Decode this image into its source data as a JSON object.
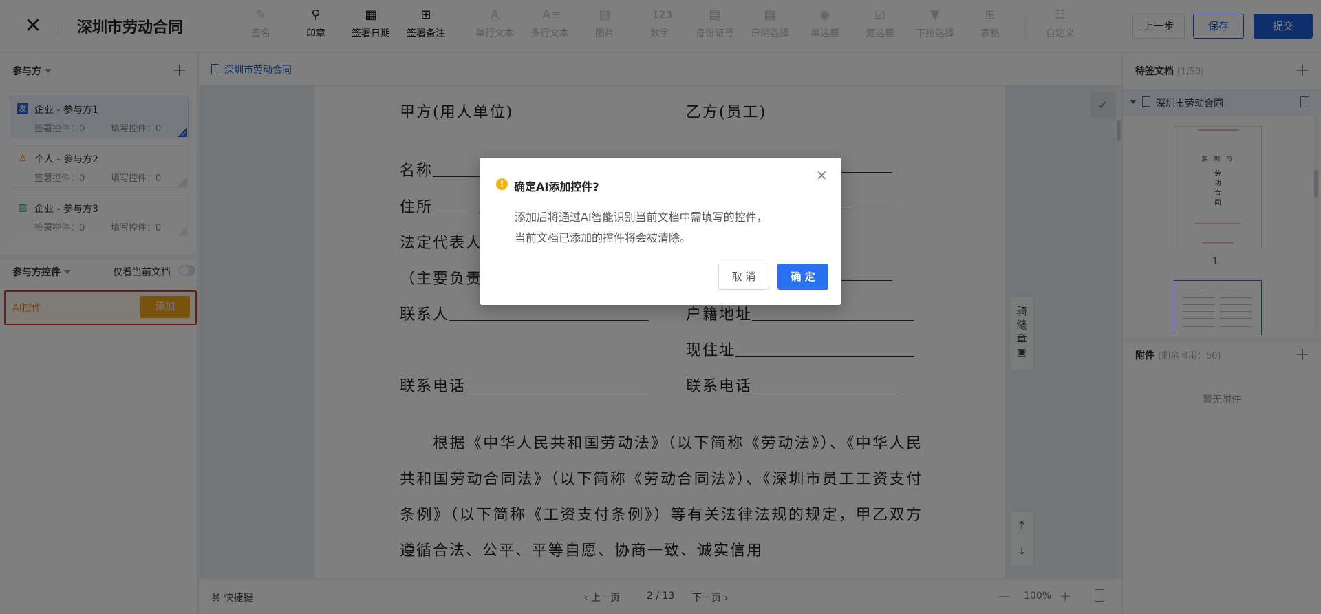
{
  "header": {
    "close_icon": "close-icon",
    "title": "深圳市劳动合同",
    "tools": [
      {
        "label": "签名",
        "icon": "pen-icon",
        "enabled": false
      },
      {
        "label": "印章",
        "icon": "stamp-icon",
        "enabled": true
      },
      {
        "label": "签署日期",
        "icon": "calendar-icon",
        "enabled": true
      },
      {
        "label": "签署备注",
        "icon": "note-plus-icon",
        "enabled": true
      },
      {
        "label": "单行文本",
        "icon": "text-a-icon",
        "enabled": false
      },
      {
        "label": "多行文本",
        "icon": "multiline-text-icon",
        "enabled": false
      },
      {
        "label": "图片",
        "icon": "image-icon",
        "enabled": false
      },
      {
        "label": "数字",
        "icon": "number-icon",
        "enabled": false,
        "glyph": "123"
      },
      {
        "label": "身份证号",
        "icon": "id-card-icon",
        "enabled": false
      },
      {
        "label": "日期选择",
        "icon": "date-picker-icon",
        "enabled": false
      },
      {
        "label": "单选框",
        "icon": "radio-icon",
        "enabled": false
      },
      {
        "label": "复选框",
        "icon": "checkbox-icon",
        "enabled": false
      },
      {
        "label": "下拉选择",
        "icon": "dropdown-icon",
        "enabled": false
      },
      {
        "label": "表格",
        "icon": "table-icon",
        "enabled": false
      },
      {
        "label": "自定义",
        "icon": "custom-sliders-icon",
        "enabled": false
      }
    ],
    "prev_step_label": "上一步",
    "save_label": "保存",
    "submit_label": "提交"
  },
  "left_panel": {
    "participants_title": "参与方",
    "participants": [
      {
        "badge": "发",
        "name": "企业 - 参与方1",
        "sign_ctrl": "签署控件：0",
        "fill_ctrl": "填写控件：0",
        "selected": true
      },
      {
        "badge": "",
        "name": "个人 - 参与方2",
        "sign_ctrl": "签署控件：0",
        "fill_ctrl": "填写控件：0",
        "selected": false
      },
      {
        "badge": "",
        "name": "企业 - 参与方3",
        "sign_ctrl": "签署控件：0",
        "fill_ctrl": "填写控件：0",
        "selected": false
      }
    ],
    "controls_title": "参与方控件",
    "only_current_doc_label": "仅看当前文档",
    "only_current_doc_on": false,
    "ai_control_label": "AI控件",
    "ai_add_label": "添加"
  },
  "document": {
    "tab_name": "深圳市劳动合同",
    "lines": {
      "party_a": "甲方(用人单位)",
      "party_b": "乙方(员工)",
      "name": "名称",
      "address": "住所",
      "legal_rep": "法定代表人",
      "main_person": "（主要负责",
      "contact": "联系人",
      "household_addr": "户籍地址",
      "current_addr": "现住址",
      "phone_a": "联系电话",
      "phone_b": "联系电话"
    },
    "paragraph": "根据《中华人民共和国劳动法》（以下简称《劳动法》）、《中华人民共和国劳动合同法》（以下简称《劳动合同法》）、《深圳市员工工资支付条例》（以下简称《工资支付条例》）等有关法律法规的规定，甲乙双方遵循合法、公平、平等自愿、协商一致、诚实信用",
    "seam_stamp_label": "骑缝章"
  },
  "bottom_bar": {
    "shortcut_label": "快捷键",
    "prev_page_label": "上一页",
    "page_indicator": "2 / 13",
    "next_page_label": "下一页",
    "zoom_minus": "—",
    "zoom": "100%",
    "zoom_plus": "+"
  },
  "right_panel": {
    "pending_title": "待签文档",
    "pending_count": "(1/50)",
    "doc_name": "深圳市劳动合同",
    "thumb_title": "深 圳 市",
    "thumb_subtitle": "劳动合同",
    "thumb_page": "1",
    "attachments_title": "附件",
    "attachments_quota": "(剩余可用：50)",
    "no_attachments": "暂无附件"
  },
  "modal": {
    "title": "确定AI添加控件?",
    "body_line1": "添加后将通过AI智能识别当前文档中需填写的控件，",
    "body_line2": "当前文档已添加的控件将会被清除。",
    "cancel_label": "取 消",
    "ok_label": "确 定"
  },
  "colors": {
    "primary": "#1d5fd6",
    "confirm": "#2b70f0",
    "ai_add": "#f0a71f",
    "highlight_border": "#e8322d",
    "warning": "#f5b400"
  }
}
